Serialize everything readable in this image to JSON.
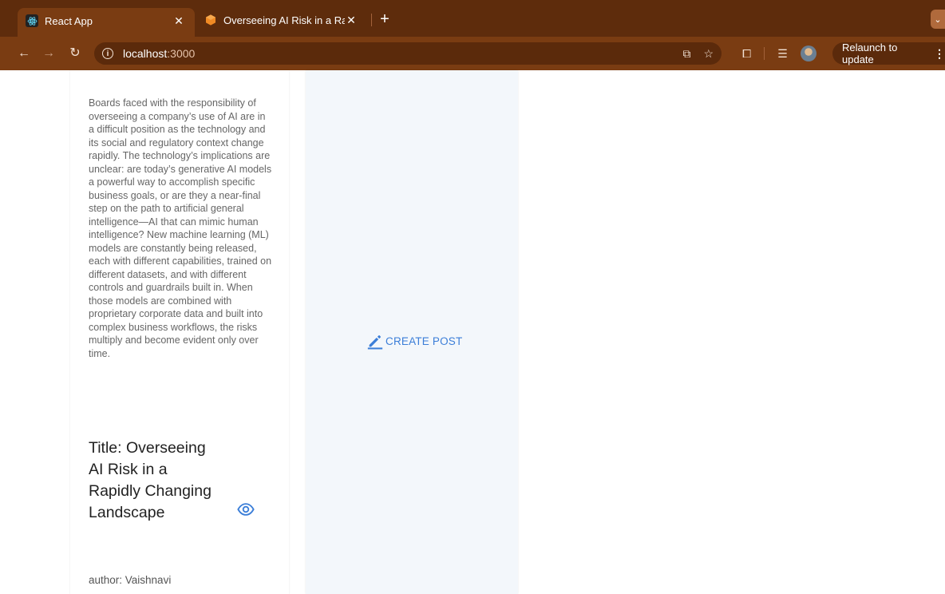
{
  "browser": {
    "tabs": [
      {
        "title": "React App",
        "icon": "react-logo-icon"
      },
      {
        "title": "Overseeing AI Risk in a Rapidl",
        "icon": "hex-logo-icon"
      }
    ],
    "url_host": "localhost",
    "url_port": ":3000",
    "relaunch_label": "Relaunch to update"
  },
  "post": {
    "body": "Boards faced with the responsibility of overseeing a company’s use of AI are in a difficult position as the technology and its social and regulatory context change rapidly. The technology’s implications are unclear: are today’s generative AI models a powerful way to accomplish specific business goals, or are they a near-final step on the path to artificial general intelligence—AI that can mimic human intelligence? New machine learning (ML) models are constantly being released, each with different capabilities, trained on different datasets, and with different controls and guardrails built in. When those models are combined with proprietary corporate data and built into complex business workflows, the risks multiply and become evident only over time.",
    "title_line": "Title: Overseeing AI Risk in a Rapidly Changing Landscape",
    "author_line": "author: Vaishnavi"
  },
  "actions": {
    "create_post_label": "CREATE POST"
  },
  "colors": {
    "tabstrip": "#5e2c0c",
    "toolbar": "#7a3c12",
    "accent": "#3b7ed8",
    "panel": "#f3f7fb"
  }
}
